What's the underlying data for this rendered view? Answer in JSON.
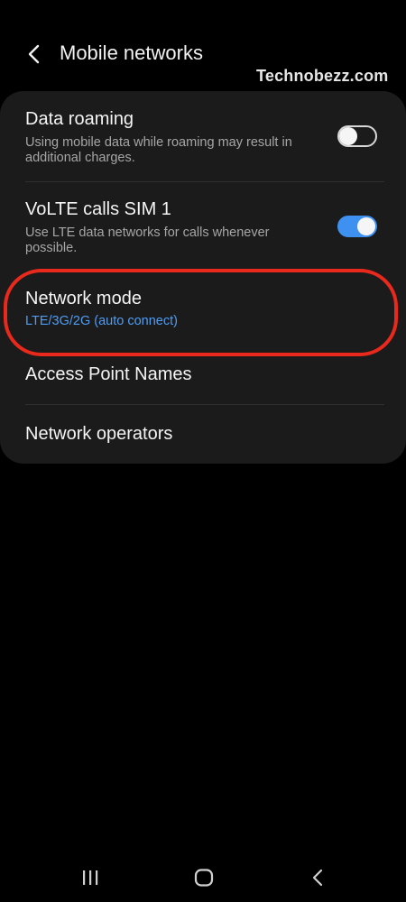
{
  "header": {
    "title": "Mobile networks",
    "back_icon": "chevron-left-icon"
  },
  "watermark": "Technobezz.com",
  "settings": {
    "data_roaming": {
      "title": "Data roaming",
      "subtitle": "Using mobile data while roaming may result in additional charges.",
      "enabled": false
    },
    "volte": {
      "title": "VoLTE calls SIM 1",
      "subtitle": "Use LTE data networks for calls whenever possible.",
      "enabled": true
    },
    "network_mode": {
      "title": "Network mode",
      "value": "LTE/3G/2G (auto connect)"
    },
    "access_point_names": {
      "title": "Access Point Names"
    },
    "network_operators": {
      "title": "Network operators"
    }
  },
  "colors": {
    "accent": "#3e91f0",
    "value_text": "#4e9df5",
    "highlight": "#e8291c",
    "card": "#1b1b1b",
    "background": "#000000"
  },
  "navbar": {
    "recents_icon": "recents-icon",
    "home_icon": "home-icon",
    "back_icon": "back-nav-icon"
  }
}
